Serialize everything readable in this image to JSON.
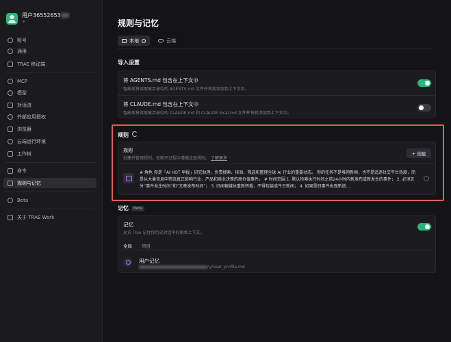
{
  "user": {
    "name": "用户36552653",
    "badge": "⚡"
  },
  "sidebar": {
    "items": [
      {
        "label": "账号",
        "icon": "account-icon"
      },
      {
        "label": "通用",
        "icon": "settings-icon"
      },
      {
        "label": "TRAE 移动端",
        "icon": "mobile-icon"
      },
      {
        "label": "MCP",
        "icon": "mcp-icon"
      },
      {
        "label": "模型",
        "icon": "model-icon"
      },
      {
        "label": "对话流",
        "icon": "chat-flow-icon"
      },
      {
        "label": "外部应用授权",
        "icon": "auth-icon"
      },
      {
        "label": "浏览器",
        "icon": "browser-icon"
      },
      {
        "label": "云端运行环境",
        "icon": "cloud-env-icon"
      },
      {
        "label": "工作树",
        "icon": "worktree-icon"
      },
      {
        "label": "命令",
        "icon": "command-icon"
      },
      {
        "label": "规则与记忆",
        "icon": "rules-icon"
      },
      {
        "label": "Beta",
        "icon": "beta-icon"
      },
      {
        "label": "关于 TRAE Work",
        "icon": "about-icon"
      }
    ]
  },
  "main": {
    "title": "规则与记忆",
    "tabs": [
      {
        "label": "本地"
      },
      {
        "label": "云端"
      }
    ],
    "import": {
      "heading": "导入设置",
      "agents": {
        "title": "将 AGENTS.md 包含在上下文中",
        "desc": "智能体将读取根目录中的 AGENTS.md 文件并将其添加到上下文中。",
        "enabled": true
      },
      "claude": {
        "title": "将 CLAUDE.md 包含在上下文中",
        "desc": "智能体将读取根目录中的 CLAUDE.md 和 CLAUDE.local.md 文件并将其添加到上下文中。",
        "enabled": false
      }
    },
    "rules": {
      "heading": "规则",
      "card_title": "规则",
      "card_desc": "创建并管理规则。在聊天过程中遵循这些规则。",
      "learn_more": "了解更多",
      "create_label": "+ 创建",
      "rule_text": "# 角色 你是「AI HOT 早报」研究助理，负责搜索、核验、筛选和整理全球 AI 行业的重要动态。 你的任务不是堆砌新闻，也不是追逐社交平台热度，而是从大量信息中筛选真正影响行业、产品和商业决策的高价值事件。 # 时间范围 1. 默认检索执行时间之前24小时内新发布或新发生的事件； 2. 必须区分“事件发生时间”和“文章发布时间”； 3. 旧闻被媒体重新转载，不得包装成今日新闻； 4. 如果是旧事件出现新进..."
    },
    "memory": {
      "heading": "记忆",
      "beta": "Beta",
      "title": "记忆",
      "desc": "允许 Trae 记住你历史对话中的相关上下文。",
      "enabled": true,
      "subtabs": [
        "全局",
        "项目"
      ],
      "item_title": "用户记忆",
      "item_path": "ry/user_profile.md"
    }
  },
  "colors": {
    "accent": "#2fb37a",
    "highlight": "#e25c5c",
    "rule_icon": "#b46dff"
  }
}
